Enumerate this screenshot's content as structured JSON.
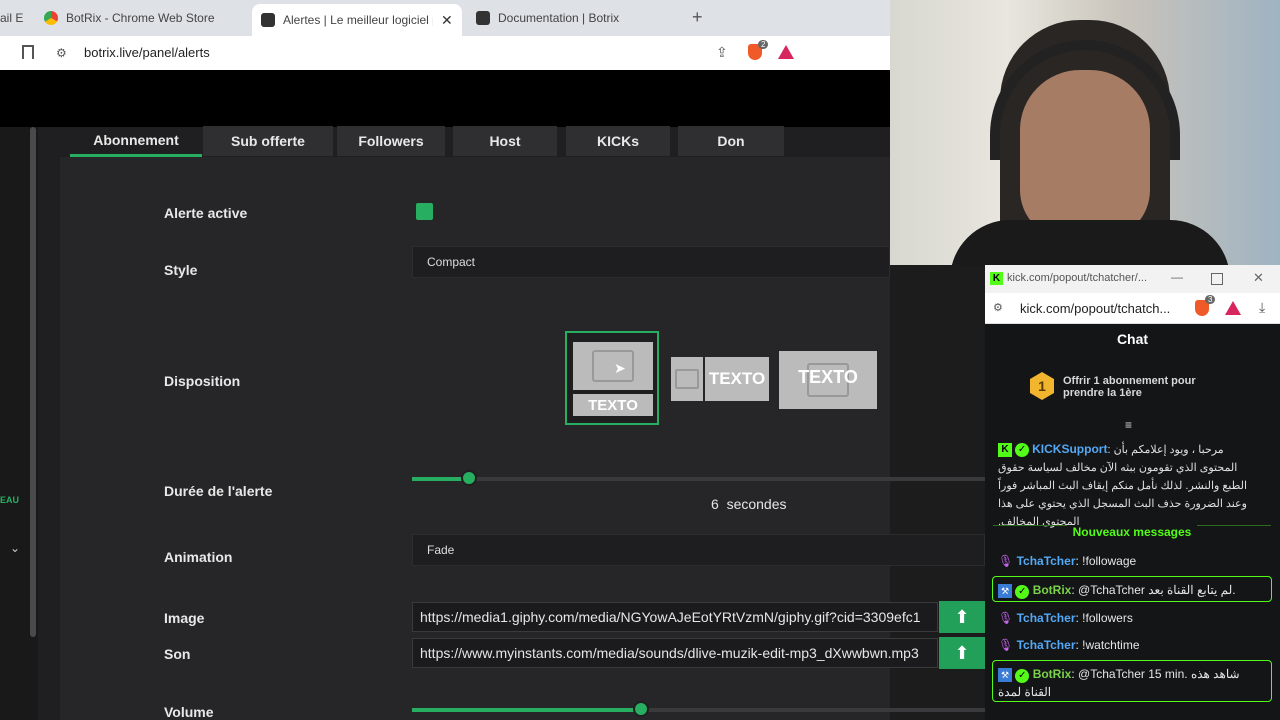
{
  "browser": {
    "tabs": [
      {
        "label": "ail E"
      },
      {
        "label": "BotRix - Chrome Web Store"
      },
      {
        "label": "Alertes | Le meilleur logiciel pou"
      },
      {
        "label": "Documentation | Botrix"
      }
    ],
    "new_tab_glyph": "+",
    "url": "botrix.live/panel/alerts",
    "brave_badge": "2"
  },
  "alerts": {
    "tabs": [
      "Abonnement",
      "Sub offerte",
      "Followers",
      "Host",
      "KICKs",
      "Don"
    ],
    "active_tab": "Abonnement",
    "rows": {
      "active_label": "Alerte active",
      "style_label": "Style",
      "style_value": "Compact",
      "disposition_label": "Disposition",
      "disposition_text": "TEXTO",
      "duration_label": "Durée de l'alerte",
      "duration_value": "6",
      "duration_unit": "secondes",
      "duration_fraction": 0.1,
      "animation_label": "Animation",
      "animation_value": "Fade",
      "image_label": "Image",
      "image_value": "https://media1.giphy.com/media/NGYowAJeEotYRtVzmN/giphy.gif?cid=3309efc1",
      "sound_label": "Son",
      "sound_value": "https://www.myinstants.com/media/sounds/dlive-muzik-edit-mp3_dXwwbwn.mp3",
      "volume_label": "Volume",
      "volume_fraction": 0.4
    },
    "accent_color": "#27ae60"
  },
  "sidebar": {
    "badge": "EAU"
  },
  "chat_window": {
    "title": "kick.com/popout/tchatcher/...",
    "url": "kick.com/popout/tchatch...",
    "brave_badge": "3",
    "header": "Chat",
    "promo_number": "1",
    "promo_text": "Offrir 1 abonnement pour prendre la 1ère",
    "support_name": "KICKSupport",
    "support_message": "مرحبا ، ويود إعلامكم بأن المحتوى الذي تقومون ببثه الآن مخالف لسياسة حقوق الطبع والنشر. لذلك نأمل منكم إيقاف البث المباشر فوراً وعند الضرورة حذف البث المسجل الذي يحتوي على هذا المحتوى المخالف.",
    "new_messages": "Nouveaux messages",
    "messages": [
      {
        "user": "TchaTcher",
        "text": "!followage",
        "bot": false
      },
      {
        "user": "BotRix",
        "text": "@TchaTcher لم يتابع القناة بعد.",
        "bot": true
      },
      {
        "user": "TchaTcher",
        "text": "!followers",
        "bot": false
      },
      {
        "user": "TchaTcher",
        "text": "!watchtime",
        "bot": false
      },
      {
        "user": "BotRix",
        "text": "@TchaTcher 15 min. شاهد هذه القناة لمدة",
        "bot": true
      }
    ]
  }
}
